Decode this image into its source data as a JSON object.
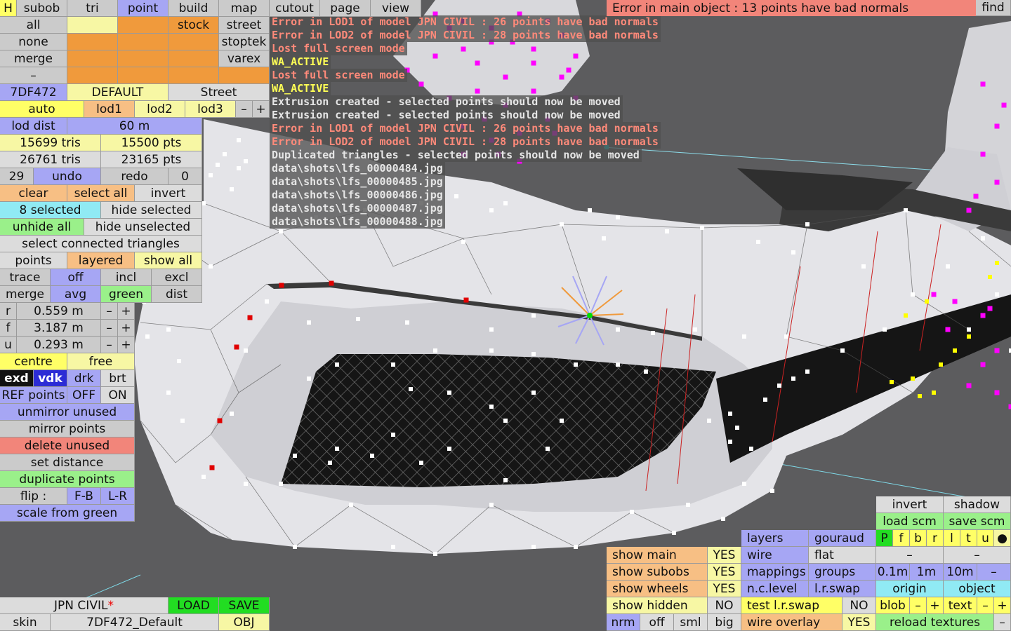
{
  "menu": {
    "h": "H",
    "subob": "subob",
    "tri": "tri",
    "point": "point",
    "build": "build",
    "map": "map",
    "cutout": "cutout",
    "page": "page",
    "view": "view"
  },
  "left": {
    "all": "all",
    "none": "none",
    "merge": "merge",
    "dash": "–",
    "stock": "stock",
    "street": "street",
    "stoptek": "stoptek",
    "varex": "varex",
    "code": "7DF472",
    "default": "DEFAULT",
    "street_label": "Street",
    "auto": "auto",
    "lod1": "lod1",
    "lod2": "lod2",
    "lod3": "lod3",
    "minus": "–",
    "plus": "+",
    "lod_dist": "lod dist",
    "lod_dist_val": "60 m",
    "tris1": "15699 tris",
    "pts1": "15500 pts",
    "tris2": "26761 tris",
    "pts2": "23165 pts",
    "undo_count": "29",
    "undo": "undo",
    "redo": "redo",
    "redo_count": "0",
    "clear": "clear",
    "select_all": "select all",
    "invert": "invert",
    "selected": "8 selected",
    "hide_selected": "hide selected",
    "unhide_all": "unhide all",
    "hide_unselected": "hide unselected",
    "select_connected": "select connected triangles",
    "points": "points",
    "layered": "layered",
    "show_all": "show all",
    "trace": "trace",
    "off": "off",
    "incl": "incl",
    "excl": "excl",
    "merge2": "merge",
    "avg": "avg",
    "green": "green",
    "dist": "dist",
    "r": "r",
    "r_val": "0.559 m",
    "f": "f",
    "f_val": "3.187 m",
    "u": "u",
    "u_val": "0.293 m",
    "centre": "centre",
    "free": "free",
    "exd": "exd",
    "vdk": "vdk",
    "drk": "drk",
    "brt": "brt",
    "ref_points": "REF points",
    "ref_off": "OFF",
    "ref_on": "ON",
    "unmirror": "unmirror unused",
    "mirror": "mirror points",
    "delete_unused": "delete unused",
    "set_distance": "set distance",
    "duplicate": "duplicate points",
    "flip": "flip :",
    "fb": "F-B",
    "lr": "L-R",
    "scale_green": "scale from green"
  },
  "bottom": {
    "model": "JPN CIVIL",
    "modified_mark": "*",
    "load": "LOAD",
    "save": "SAVE",
    "skin": "skin",
    "skin_name": "7DF472_Default",
    "obj": "OBJ"
  },
  "messages": [
    {
      "text": "Error in LOD1 of model JPN CIVIL : 26 points have bad normals",
      "kind": "err"
    },
    {
      "text": "Error in LOD2 of model JPN CIVIL : 28 points have bad normals",
      "kind": "err"
    },
    {
      "text": "Lost full screen mode",
      "kind": "err"
    },
    {
      "text": "WA_ACTIVE",
      "kind": "wa"
    },
    {
      "text": "Lost full screen mode",
      "kind": "err"
    },
    {
      "text": "WA_ACTIVE",
      "kind": "wa"
    },
    {
      "text": "Extrusion created - selected points should now be moved",
      "kind": "inf"
    },
    {
      "text": "Extrusion created - selected points should now be moved",
      "kind": "inf"
    },
    {
      "text": "Error in LOD1 of model JPN CIVIL : 26 points have bad normals",
      "kind": "err"
    },
    {
      "text": "Error in LOD2 of model JPN CIVIL : 28 points have bad normals",
      "kind": "err"
    },
    {
      "text": "Duplicated triangles - selected points should now be moved",
      "kind": "inf"
    },
    {
      "text": "data\\shots\\lfs_00000484.jpg",
      "kind": "inf"
    },
    {
      "text": "data\\shots\\lfs_00000485.jpg",
      "kind": "inf"
    },
    {
      "text": "data\\shots\\lfs_00000486.jpg",
      "kind": "inf"
    },
    {
      "text": "data\\shots\\lfs_00000487.jpg",
      "kind": "inf"
    },
    {
      "text": "data\\shots\\lfs_00000488.jpg",
      "kind": "inf"
    }
  ],
  "topright": {
    "error": "Error in main object : 13 points have bad normals",
    "find": "find"
  },
  "view": {
    "show_main": "show main",
    "show_main_v": "YES",
    "show_subobs": "show subobs",
    "show_subobs_v": "YES",
    "show_wheels": "show wheels",
    "show_wheels_v": "YES",
    "show_hidden": "show hidden",
    "show_hidden_v": "NO",
    "nrm": "nrm",
    "off": "off",
    "sml": "sml",
    "big": "big",
    "layers": "layers",
    "gouraud": "gouraud",
    "wire": "wire",
    "flat": "flat",
    "mappings": "mappings",
    "groups": "groups",
    "nc_level": "n.c.level",
    "lr_swap": "l.r.swap",
    "test_lr_swap": "test l.r.swap",
    "test_v": "NO",
    "wire_overlay": "wire overlay",
    "wire_overlay_v": "YES",
    "invert": "invert",
    "shadow": "shadow",
    "load_scm": "load scm",
    "save_scm": "save scm",
    "flags": [
      "P",
      "f",
      "b",
      "r",
      "l",
      "t",
      "u",
      "●"
    ],
    "d1": "–",
    "d2": "–",
    "m01": "0.1m",
    "m1": "1m",
    "m10": "10m",
    "mdash": "–",
    "origin": "origin",
    "object": "object",
    "blob": "blob",
    "bm": "–",
    "bp": "+",
    "text": "text",
    "tm": "–",
    "tp": "+",
    "reload": "reload textures",
    "rdash": "–"
  },
  "colors": {
    "selected_point": "#ff00ff",
    "yellow_point": "#ffff00",
    "red_point": "#e00000",
    "vertex": "#ffffff",
    "background": "#5c5c5e",
    "mesh": "#e4e4e8"
  }
}
